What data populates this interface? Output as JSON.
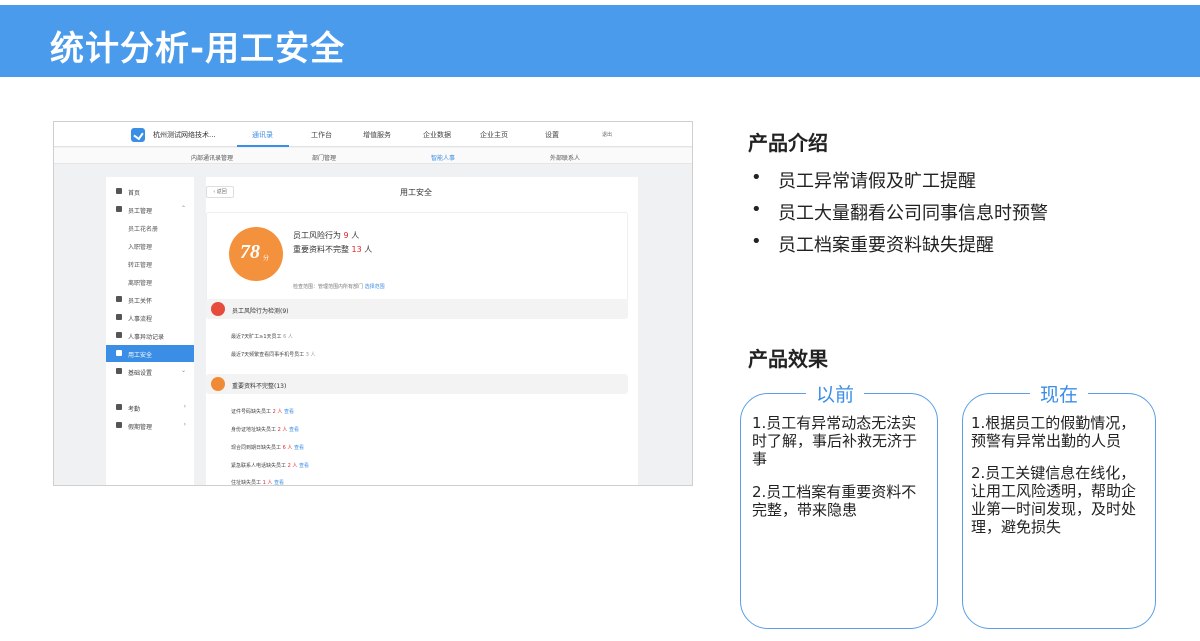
{
  "banner": {
    "title": "统计分析-用工安全"
  },
  "screenshot": {
    "company": "杭州测试网络技术...",
    "nav": [
      "通讯录",
      "工作台",
      "增值服务",
      "企业数据",
      "企业主页",
      "设置"
    ],
    "nav_active": "通讯录",
    "logout": "退出",
    "subnav": [
      "内部通讯录管理",
      "部门管理",
      "智能人事",
      "外部联系人"
    ],
    "subnav_active": "智能人事",
    "sidebar": {
      "home": "首页",
      "staff_mgmt": "员工管理",
      "staff_sub": [
        "员工花名册",
        "入职管理",
        "转正管理",
        "离职管理"
      ],
      "care": "员工关怀",
      "hr_flow": "人事流程",
      "changes": "人事异动记录",
      "safety": "用工安全",
      "base": "基础设置",
      "attendance": "考勤",
      "leave": "假期管理",
      "caret_up": "⌃",
      "caret_down": "⌄",
      "caret_right": "›"
    },
    "main": {
      "back": "‹ 返回",
      "title": "用工安全",
      "score": "78",
      "score_unit": "分",
      "risk_label": "员工风险行为",
      "risk_count": "9",
      "risk_unit": "人",
      "missing_label": "重要资料不完整",
      "missing_count": "13",
      "missing_unit": "人",
      "scope_label": "检查范围：管理范围内所有部门",
      "scope_link": "选择范围",
      "section1": "员工风险行为检测(9)",
      "s1_rows": [
        {
          "label": "最近7天旷工≥1天员工",
          "count": "6 人"
        },
        {
          "label": "最近7天频繁查看同事手机号员工",
          "count": "3 人"
        }
      ],
      "section2": "重要资料不完整(13)",
      "s2_rows": [
        {
          "label": "证件号码缺失员工",
          "count": "2 人",
          "see": "查看"
        },
        {
          "label": "身份证地址缺失员工",
          "count": "2 人",
          "see": "查看"
        },
        {
          "label": "现合同到期日缺失员工",
          "count": "6 人",
          "see": "查看"
        },
        {
          "label": "紧急联系人电话缺失员工",
          "count": "2 人",
          "see": "查看"
        },
        {
          "label": "住址缺失员工",
          "count": "1 人",
          "see": "查看"
        }
      ]
    }
  },
  "intro": {
    "heading": "产品介绍",
    "bullet_char": "•",
    "items": [
      "员工异常请假及旷工提醒",
      "员工大量翻看公司同事信息时预警",
      "员工档案重要资料缺失提醒"
    ]
  },
  "effect": {
    "heading": "产品效果",
    "before": {
      "label": "以前",
      "items": [
        "1.员工有异常动态无法实时了解，事后补救无济于事",
        "2.员工档案有重要资料不完整，带来隐患"
      ]
    },
    "after": {
      "label": "现在",
      "items": [
        "1.根据员工的假勤情况，预警有异常出勤的人员",
        "2.员工关键信息在线化，让用工风险透明，帮助企业第一时间发现，及时处理，避免损失"
      ]
    }
  }
}
